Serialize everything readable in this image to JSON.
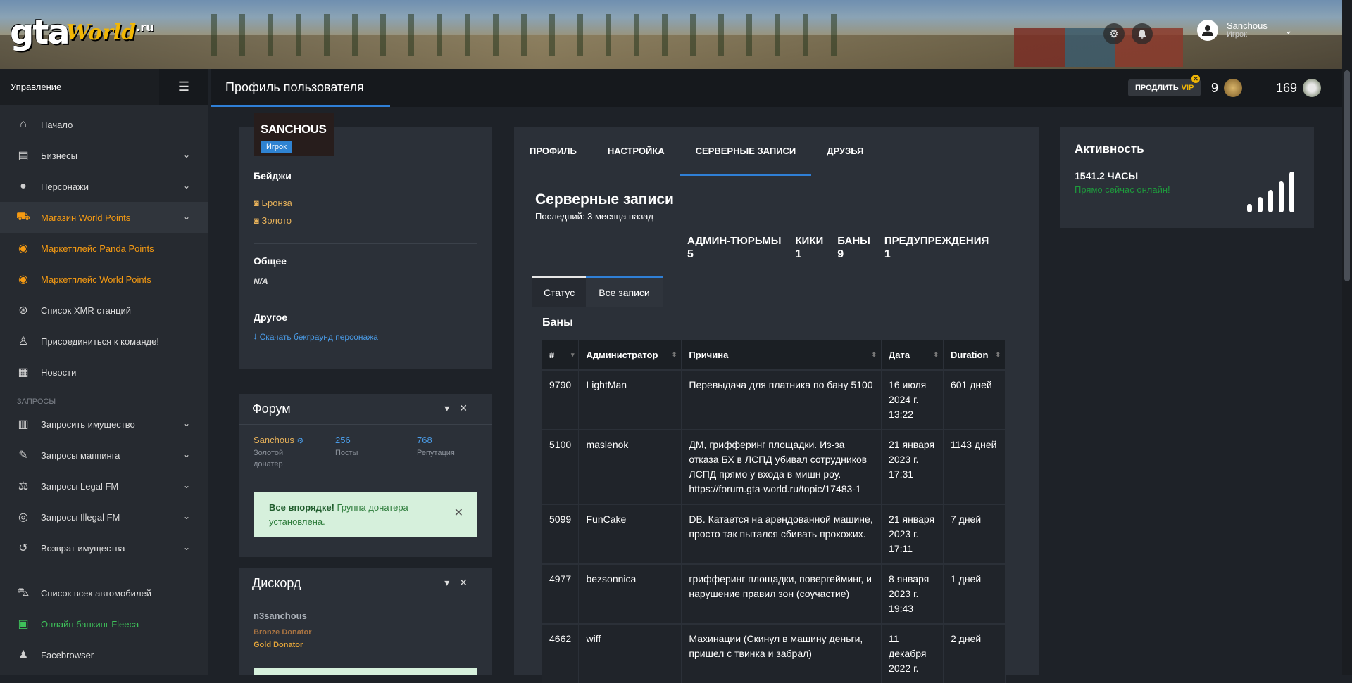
{
  "header": {
    "logo": {
      "gta": "gta",
      "world": "World",
      "ru": ".ru"
    },
    "user": {
      "name": "Sanchous",
      "role": "Игрок"
    },
    "page_title": "Профиль пользователя",
    "vip_button": {
      "prefix": "ПРОДЛИТЬ",
      "vip": "VIP",
      "close": "✕"
    },
    "stats": [
      {
        "value": "9"
      },
      {
        "value": "169"
      }
    ]
  },
  "sidebar": {
    "heading": "Управление",
    "items": [
      {
        "label": "Начало",
        "icon": "home-icon"
      },
      {
        "label": "Бизнесы",
        "icon": "briefcase-icon"
      },
      {
        "label": "Персонажи",
        "icon": "user-icon"
      },
      {
        "label": "Магазин World Points",
        "icon": "cart-icon"
      },
      {
        "label": "Маркетплейс Panda Points",
        "icon": "coins-icon"
      },
      {
        "label": "Маркетплейс World Points",
        "icon": "coins-icon"
      },
      {
        "label": "Список XMR станций",
        "icon": "antenna-icon"
      },
      {
        "label": "Присоединиться к команде!",
        "icon": "user-tie-icon"
      },
      {
        "label": "Новости",
        "icon": "newspaper-icon"
      }
    ],
    "section": "ЗАПРОСЫ",
    "requests": [
      {
        "label": "Запросить имущество",
        "icon": "building-icon"
      },
      {
        "label": "Запросы маппинга",
        "icon": "brush-icon"
      },
      {
        "label": "Запросы Legal FM",
        "icon": "scale-icon"
      },
      {
        "label": "Запросы Illegal FM",
        "icon": "mask-icon"
      },
      {
        "label": "Возврат имущества",
        "icon": "undo-icon"
      }
    ],
    "bottom": [
      {
        "label": "Список всех автомобилей",
        "icon": "car-icon"
      },
      {
        "label": "Онлайн банкинг Fleeca",
        "icon": "money-icon"
      },
      {
        "label": "Facebrowser",
        "icon": "users-icon"
      }
    ]
  },
  "profile": {
    "name": "SANCHOUS",
    "role": "Игрок",
    "badges_title": "Бейджи",
    "badges": [
      "Бронза",
      "Золото"
    ],
    "general_title": "Общее",
    "general_value": "N/A",
    "other_title": "Другое",
    "download_link": "Скачать бекграунд персонажа"
  },
  "forum": {
    "title": "Форум",
    "username": "Sanchous",
    "rank_line1": "Золотой",
    "rank_line2": "донатер",
    "posts": "256",
    "posts_label": "Посты",
    "reputation": "768",
    "reputation_label": "Репутация",
    "alert_bold": "Все впорядке!",
    "alert_text": " Группа донатера установлена."
  },
  "discord": {
    "title": "Дискорд",
    "username": "n3sanchous",
    "role1": "Bronze Donator",
    "role2": "Gold Donator"
  },
  "tabs": [
    "ПРОФИЛЬ",
    "НАСТРОЙКА",
    "СЕРВЕРНЫЕ ЗАПИСИ",
    "ДРУЗЬЯ"
  ],
  "records": {
    "title": "Серверные записи",
    "subtitle": "Последний: 3 месяца назад",
    "counts": [
      {
        "label": "АДМИН-ТЮРЬМЫ",
        "value": "5"
      },
      {
        "label": "КИКИ",
        "value": "1"
      },
      {
        "label": "БАНЫ",
        "value": "9"
      },
      {
        "label": "ПРЕДУПРЕЖДЕНИЯ",
        "value": "1"
      }
    ],
    "subtabs": [
      "Статус",
      "Все записи"
    ],
    "bans_title": "Баны",
    "columns": [
      "#",
      "Администратор",
      "Причина",
      "Дата",
      "Duration"
    ],
    "rows": [
      {
        "id": "9790",
        "admin": "LightMan",
        "reason": "Перевыдача для платника по бану 5100",
        "date": "16 июля 2024 г. 13:22",
        "duration": "601 дней"
      },
      {
        "id": "5100",
        "admin": "maslenok",
        "reason": "ДМ, грифферинг площадки. Из-за отказа БХ в ЛСПД убивал сотрудников ЛСПД прямо у входа в мишн роу. https://forum.gta-world.ru/topic/17483-1",
        "date": "21 января 2023 г. 17:31",
        "duration": "1143 дней"
      },
      {
        "id": "5099",
        "admin": "FunCake",
        "reason": "DB. Катается на арендованной машине, просто так пытался сбивать прохожих.",
        "date": "21 января 2023 г. 17:11",
        "duration": "7 дней"
      },
      {
        "id": "4977",
        "admin": "bezsonnica",
        "reason": "грифферинг площадки, повергейминг, и нарушение правил зон (соучастие)",
        "date": "8 января 2023 г. 19:43",
        "duration": "1 дней"
      },
      {
        "id": "4662",
        "admin": "wiff",
        "reason": "Махинации (Скинул в машину деньги, пришел с твинка и забрал)",
        "date": "11 декабря 2022 г.",
        "duration": "2 дней"
      }
    ]
  },
  "activity": {
    "title": "Активность",
    "hours": "1541.2 ЧАСЫ",
    "status": "Прямо сейчас онлайн!"
  }
}
